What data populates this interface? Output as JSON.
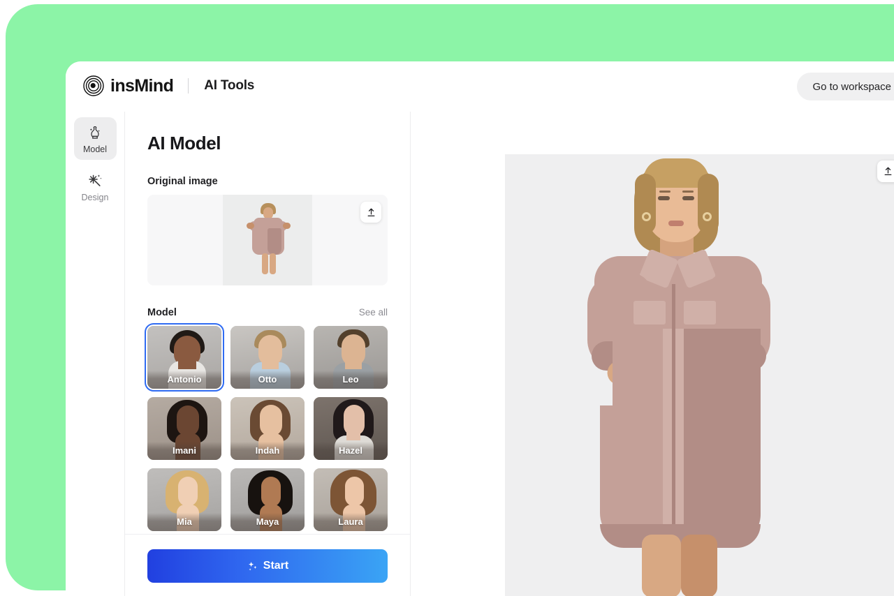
{
  "brand": {
    "name": "insMind",
    "sub": "AI Tools",
    "logo_icon": "concentric-circles-logo"
  },
  "topbar": {
    "workspace_label": "Go to workspace"
  },
  "rail": {
    "items": [
      {
        "label": "Model",
        "icon": "dress-form-icon",
        "active": true
      },
      {
        "label": "Design",
        "icon": "magic-sparkle-icon",
        "active": false
      }
    ]
  },
  "panel": {
    "title": "AI Model",
    "original_image_label": "Original image",
    "upload_icon": "upload-arrow-icon",
    "model_section": {
      "label": "Model",
      "see_all_label": "See all",
      "selected": "Antonio",
      "items": [
        {
          "name": "Antonio",
          "selected": true
        },
        {
          "name": "Otto",
          "selected": false
        },
        {
          "name": "Leo",
          "selected": false
        },
        {
          "name": "Imani",
          "selected": false
        },
        {
          "name": "Indah",
          "selected": false
        },
        {
          "name": "Hazel",
          "selected": false
        },
        {
          "name": "Mia",
          "selected": false
        },
        {
          "name": "Maya",
          "selected": false
        },
        {
          "name": "Laura",
          "selected": false
        }
      ]
    },
    "start_button": {
      "label": "Start",
      "icon": "sparkles-icon"
    }
  },
  "canvas": {
    "upload_icon": "upload-arrow-icon",
    "preview_alt": "model-in-dusty-rose-shirt-dress"
  },
  "colors": {
    "backdrop_green": "#8cf4a7",
    "accent_blue": "#2f6bf2",
    "start_gradient_from": "#2140e0",
    "start_gradient_to": "#3aa4f5",
    "panel_bg": "#ffffff",
    "preview_bg": "#efeff0",
    "dress": "#c4a098"
  }
}
